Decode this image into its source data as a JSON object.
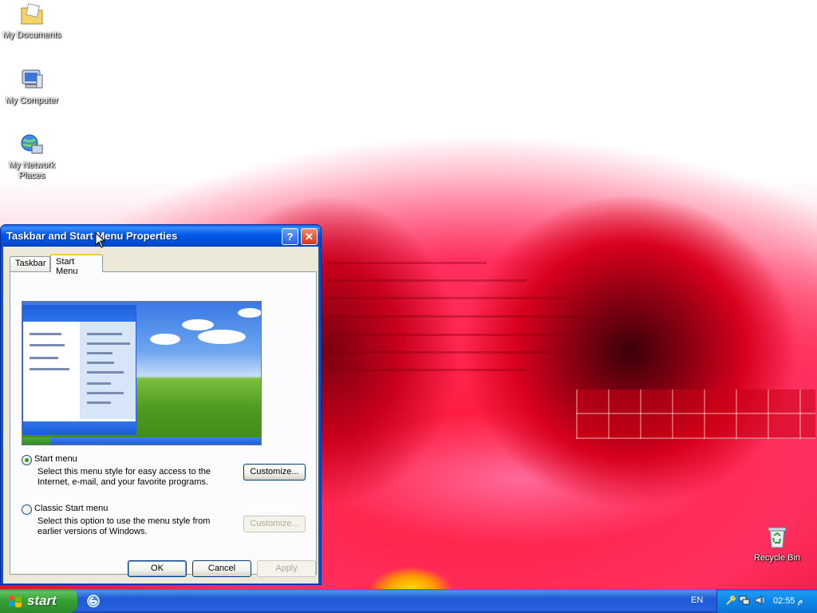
{
  "desktop": {
    "icons": [
      {
        "label": "My Documents",
        "icon": "my-documents-icon"
      },
      {
        "label": "My Computer",
        "icon": "my-computer-icon"
      },
      {
        "label": "My Network Places",
        "icon": "network-places-icon"
      },
      {
        "label": "Recycle Bin",
        "icon": "recycle-bin-icon"
      }
    ]
  },
  "dialog": {
    "title": "Taskbar and Start Menu Properties",
    "help_symbol": "?",
    "close_symbol": "✕",
    "tabs": [
      {
        "label": "Taskbar",
        "selected": false
      },
      {
        "label": "Start Menu",
        "selected": true
      }
    ],
    "options": [
      {
        "label": "Start menu",
        "description": "Select this menu style for easy access to the Internet, e-mail, and your favorite programs.",
        "selected": true,
        "button": "Customize...",
        "button_enabled": true
      },
      {
        "label": "Classic Start menu",
        "description": "Select this option to use the menu style from earlier versions of Windows.",
        "selected": false,
        "button": "Customize...",
        "button_enabled": false
      }
    ],
    "buttons": {
      "ok": "OK",
      "cancel": "Cancel",
      "apply": "Apply"
    }
  },
  "taskbar": {
    "start_label": "start",
    "language": "EN",
    "clock": "02:55 م"
  },
  "colors": {
    "titlebar": "#0058e6",
    "taskbar": "#2157d7",
    "start_button": "#37a437",
    "dialog_face": "#ece9d8",
    "tab_highlight": "#ffc83c"
  }
}
